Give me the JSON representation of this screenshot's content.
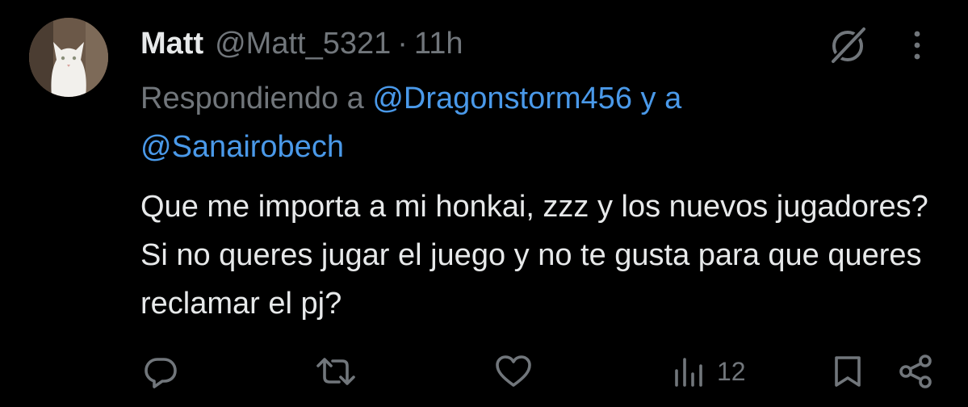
{
  "tweet": {
    "author_name": "Matt",
    "author_handle": "@Matt_5321",
    "separator": "·",
    "time": "11h",
    "replying_prefix": "Respondiendo a",
    "reply_mentions": [
      "@Dragonstorm456",
      "@Sanairobech"
    ],
    "reply_joiner": "y a",
    "text": "Que me importa a mi honkai, zzz y los nuevos jugadores? Si no queres jugar el juego y no te gusta para que queres reclamar el pj?"
  },
  "actions": {
    "views_count": "12"
  },
  "icons": {
    "avatar": "white-cat-avatar",
    "grok": "grok-icon",
    "more": "more-vertical-icon",
    "reply": "reply-icon",
    "retweet": "retweet-icon",
    "like": "heart-icon",
    "views": "analytics-icon",
    "bookmark": "bookmark-icon",
    "share": "share-icon"
  },
  "colors": {
    "background": "#000000",
    "text": "#e7e9ea",
    "muted": "#71767b",
    "link": "#4a99e9"
  }
}
